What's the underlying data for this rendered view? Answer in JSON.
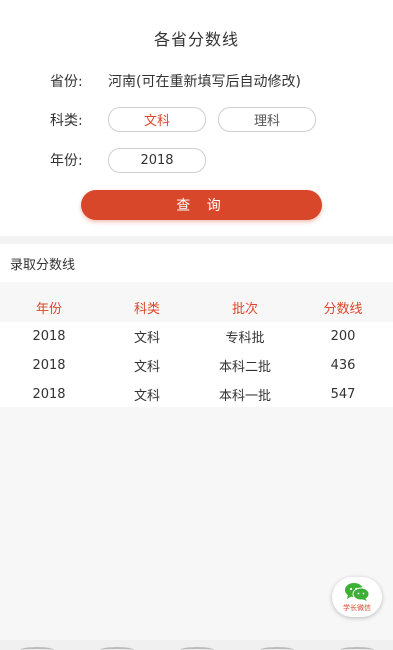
{
  "header": {
    "title": "各省分数线"
  },
  "form": {
    "province_label": "省份:",
    "province_value": "河南(可在重新填写后自动修改)",
    "subject_label": "科类:",
    "subject_options": [
      {
        "label": "文科",
        "selected": true
      },
      {
        "label": "理科",
        "selected": false
      }
    ],
    "year_label": "年份:",
    "year_value": "2018",
    "query_label": "查 询"
  },
  "results": {
    "section_title": "录取分数线",
    "columns": [
      "年份",
      "科类",
      "批次",
      "分数线"
    ],
    "rows": [
      [
        "2018",
        "文科",
        "专科批",
        "200"
      ],
      [
        "2018",
        "文科",
        "本科二批",
        "436"
      ],
      [
        "2018",
        "文科",
        "本科一批",
        "547"
      ]
    ]
  },
  "wechat": {
    "label": "学长微信",
    "icon": "wechat-icon"
  },
  "colors": {
    "accent": "#d9472b",
    "wechat_green": "#3cb034"
  }
}
